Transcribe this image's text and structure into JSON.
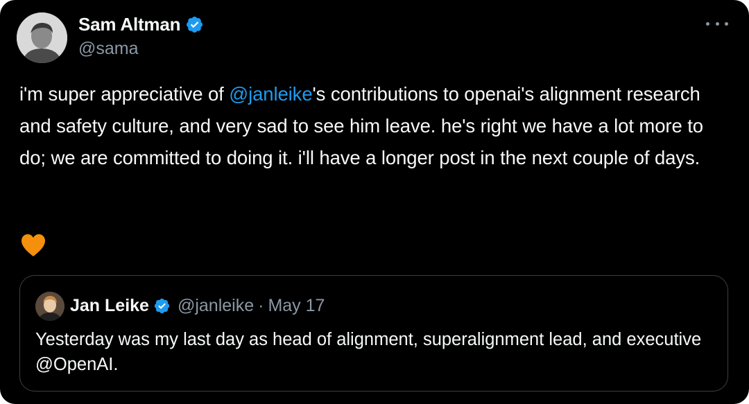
{
  "tweet": {
    "author_name": "Sam Altman",
    "author_handle": "@sama",
    "text_before_mention": "i'm super appreciative of ",
    "mention": "@janleike",
    "text_after_mention": "'s contributions to openai's alignment research and safety culture, and very sad to see him leave. he's right we have a lot more to do; we are committed to doing it. i'll have a longer post in the next couple of days.",
    "emoji": "orange-heart",
    "more_icon": "more-horizontal-icon"
  },
  "quoted_tweet": {
    "author_name": "Jan Leike",
    "author_handle": "@janleike",
    "separator": "·",
    "date": "May 17",
    "text": "Yesterday was my last day as head of alignment, superalignment lead, and executive @OpenAI."
  },
  "colors": {
    "background": "#000000",
    "text": "#f7f9f9",
    "secondary_text": "#8b98a5",
    "link": "#1d9bf0",
    "verified_badge": "#1d9bf0",
    "heart": "#f4900c",
    "border": "#3b4045"
  }
}
